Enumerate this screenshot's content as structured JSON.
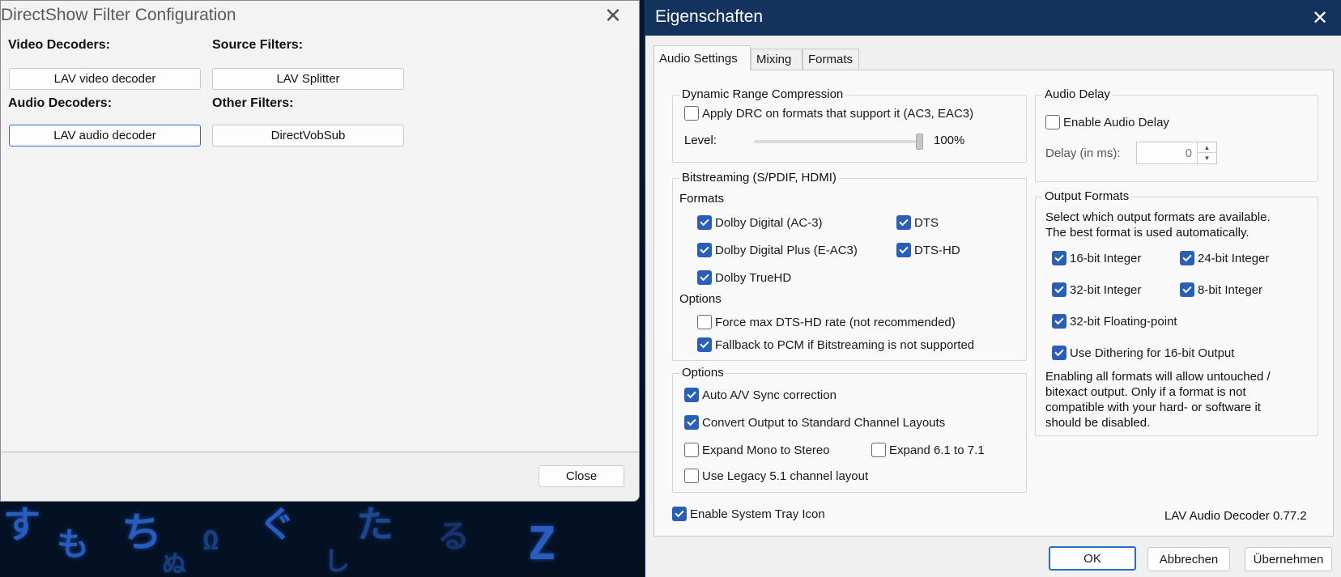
{
  "background_glyphs": [
    "す",
    "も",
    "ち",
    "Ω",
    "ぐ",
    "Z",
    "た",
    "る",
    "ぬ",
    "し"
  ],
  "left_window": {
    "title": "DirectShow Filter Configuration",
    "video_decoders_label": "Video Decoders:",
    "video_decoder_button": "LAV video decoder",
    "source_filters_label": "Source Filters:",
    "source_filter_button": "LAV Splitter",
    "audio_decoders_label": "Audio Decoders:",
    "audio_decoder_button": "LAV audio decoder",
    "other_filters_label": "Other Filters:",
    "other_filter_button": "DirectVobSub",
    "close_button": "Close"
  },
  "right_window": {
    "title": "Eigenschaften",
    "tabs": [
      {
        "label": "Audio Settings",
        "active": true
      },
      {
        "label": "Mixing",
        "active": false
      },
      {
        "label": "Formats",
        "active": false
      }
    ],
    "drc": {
      "title": "Dynamic Range Compression",
      "apply_drc": {
        "label": "Apply DRC on formats that support it (AC3, EAC3)",
        "checked": false
      },
      "level_label": "Level:",
      "level_value": "100%",
      "level_fraction": 1.0
    },
    "bitstreaming": {
      "title": "Bitstreaming (S/PDIF, HDMI)",
      "formats_label": "Formats",
      "formats": [
        {
          "label": "Dolby Digital (AC-3)",
          "checked": true
        },
        {
          "label": "DTS",
          "checked": true
        },
        {
          "label": "Dolby Digital Plus (E-AC3)",
          "checked": true
        },
        {
          "label": "DTS-HD",
          "checked": true
        },
        {
          "label": "Dolby TrueHD",
          "checked": true
        }
      ],
      "options_label": "Options",
      "options": [
        {
          "label": "Force max DTS-HD rate (not recommended)",
          "checked": false
        },
        {
          "label": "Fallback to PCM if Bitstreaming is not supported",
          "checked": true
        }
      ]
    },
    "options": {
      "title": "Options",
      "items": [
        {
          "label": "Auto A/V Sync correction",
          "checked": true
        },
        {
          "label": "Convert Output to Standard Channel Layouts",
          "checked": true
        },
        {
          "label": "Expand Mono to Stereo",
          "checked": false
        },
        {
          "label": "Expand 6.1 to 7.1",
          "checked": false
        },
        {
          "label": "Use Legacy 5.1 channel layout",
          "checked": false
        }
      ]
    },
    "audio_delay": {
      "title": "Audio Delay",
      "enable": {
        "label": "Enable Audio Delay",
        "checked": false
      },
      "delay_label": "Delay (in ms):",
      "delay_value": "0"
    },
    "output_formats": {
      "title": "Output Formats",
      "description_line1": "Select which output formats are available.",
      "description_line2": "The best format is used automatically.",
      "items": [
        {
          "label": "16-bit Integer",
          "checked": true
        },
        {
          "label": "24-bit Integer",
          "checked": true
        },
        {
          "label": "32-bit Integer",
          "checked": true
        },
        {
          "label": "8-bit Integer",
          "checked": true
        },
        {
          "label": "32-bit Floating-point",
          "checked": true
        },
        {
          "label": "Use Dithering for 16-bit Output",
          "checked": true
        }
      ],
      "note_lines": [
        "Enabling all formats will allow untouched /",
        "bitexact output. Only if a format is not",
        "compatible with your hard- or software it",
        "should be disabled."
      ]
    },
    "tray_icon": {
      "label": "Enable System Tray Icon",
      "checked": true
    },
    "version": "LAV Audio Decoder 0.77.2",
    "ok_button": "OK",
    "cancel_button": "Abbrechen",
    "apply_button": "Übernehmen"
  }
}
